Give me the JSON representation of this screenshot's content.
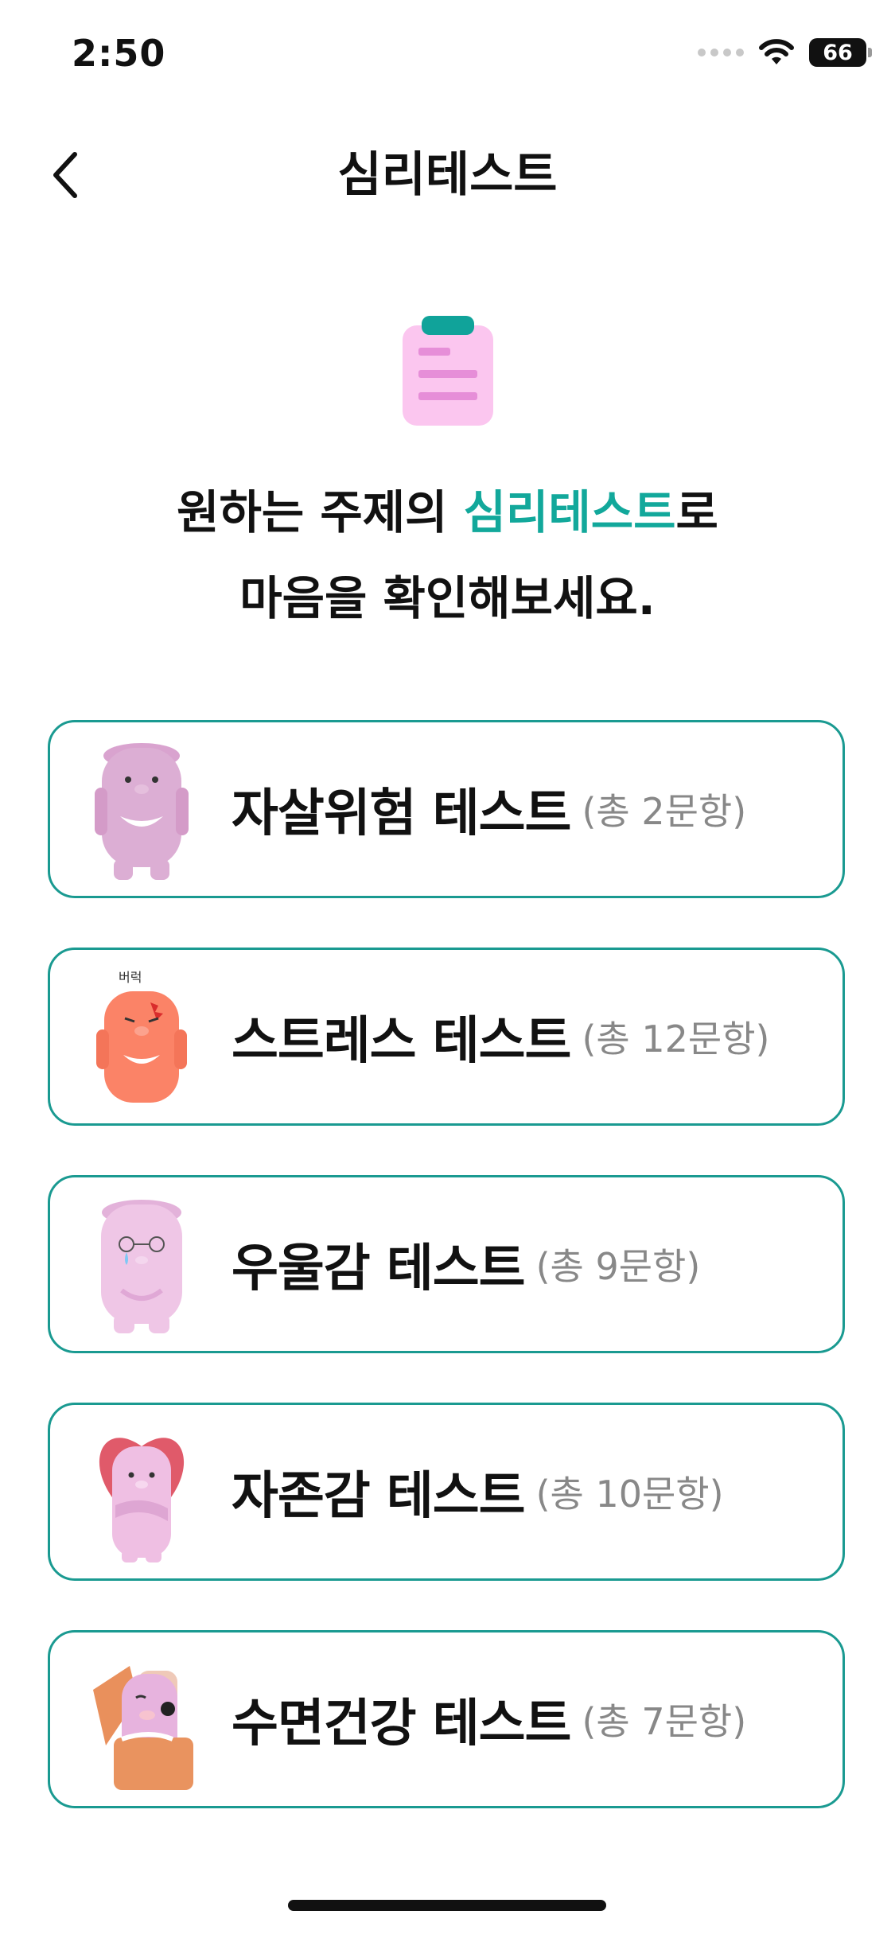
{
  "status_bar": {
    "time": "2:50",
    "battery": "66"
  },
  "header": {
    "title": "심리테스트"
  },
  "headline": {
    "line1_pre": "원하는 주제의 ",
    "line1_accent": "심리테스트",
    "line1_post": "로",
    "line2": "마음을 확인해보세요."
  },
  "colors": {
    "accent": "#12a89b",
    "card_border": "#1a9a91",
    "count_gray": "#888888"
  },
  "tests": [
    {
      "title": "자살위험 테스트",
      "count": "(총 2문항)",
      "character": "pink-bear-smiling"
    },
    {
      "title": "스트레스 테스트",
      "count": "(총 12문항)",
      "character": "orange-bear-angry",
      "caption": "버럭"
    },
    {
      "title": "우울감 테스트",
      "count": "(총 9문항)",
      "character": "pink-bear-crying"
    },
    {
      "title": "자존감 테스트",
      "count": "(총 10문항)",
      "character": "pink-bear-heart"
    },
    {
      "title": "수면건강 테스트",
      "count": "(총 7문항)",
      "character": "pink-bear-sleeping"
    }
  ]
}
